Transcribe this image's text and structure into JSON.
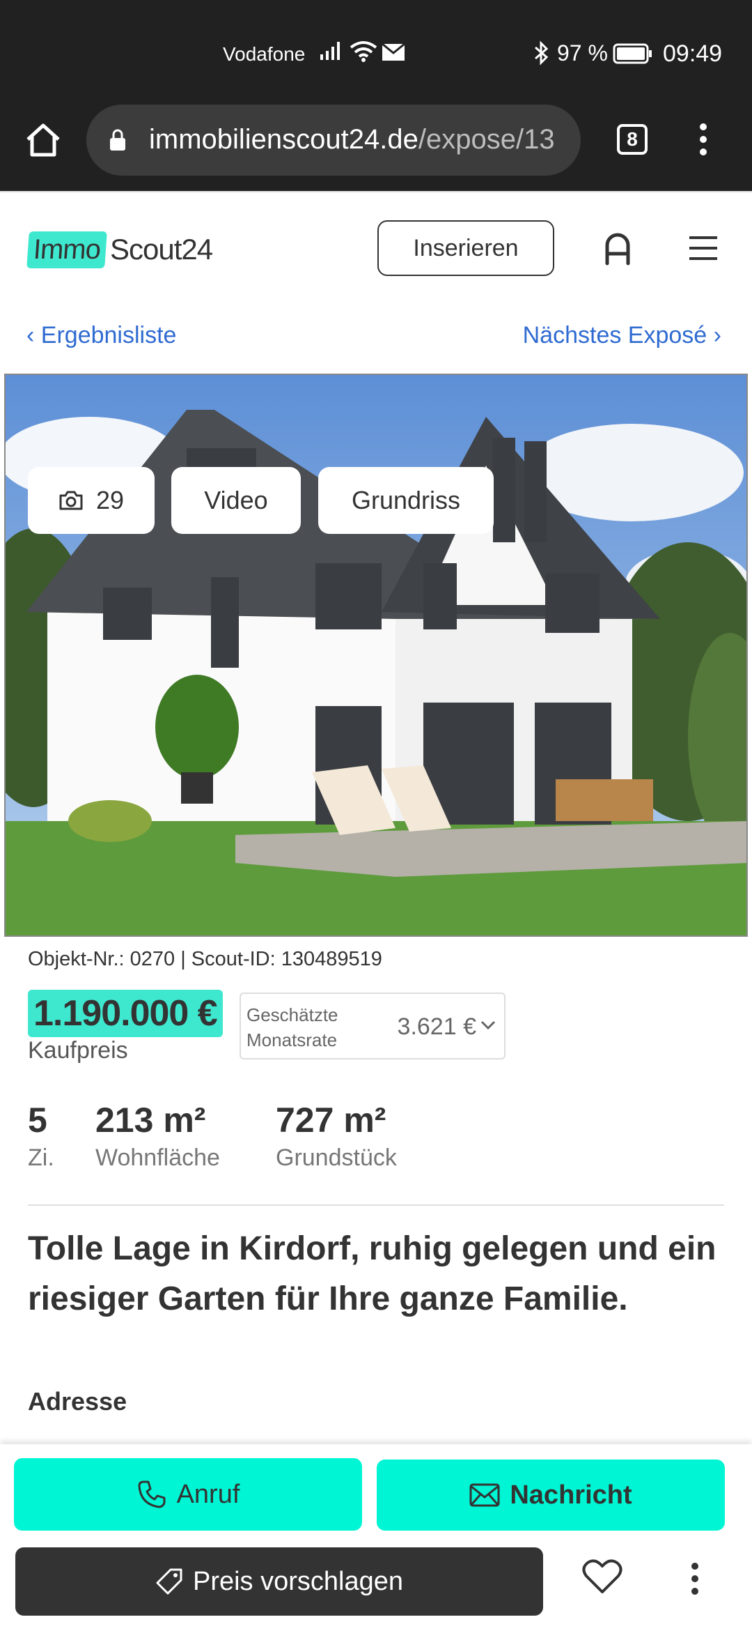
{
  "status_bar": {
    "carrier": "Vodafone",
    "battery": "97 %",
    "time": "09:49"
  },
  "browser": {
    "url_domain": "immobilienscout24.de",
    "url_path": "/expose/13",
    "tab_count": "8"
  },
  "header": {
    "logo_part1": "Immo",
    "logo_part2": "Scout24",
    "insert_label": "Inserieren"
  },
  "nav": {
    "back_label": "Ergebnisliste",
    "next_label": "Nächstes Exposé"
  },
  "gallery": {
    "photo_count": "29",
    "video_label": "Video",
    "floorplan_label": "Grundriss"
  },
  "listing": {
    "object_ids": "Objekt-Nr.: 0270 | Scout-ID: 130489519",
    "price": "1.190.000 €",
    "price_label": "Kaufpreis",
    "rate_label": "Geschätzte Monatsrate",
    "rate_value": "3.621 €",
    "facts": [
      {
        "value": "5",
        "label": "Zi."
      },
      {
        "value": "213 m²",
        "label": "Wohnfläche"
      },
      {
        "value": "727 m²",
        "label": "Grundstück"
      }
    ],
    "headline": "Tolle Lage in Kirdorf, ruhig gelegen und ein riesiger Garten für Ihre ganze Familie.",
    "address_label": "Adresse"
  },
  "actions": {
    "call_label": "Anruf",
    "message_label": "Nachricht",
    "offer_label": "Preis vorschlagen"
  },
  "colors": {
    "accent": "#00f5d4",
    "link": "#2f6bd1",
    "dark": "#333333"
  }
}
